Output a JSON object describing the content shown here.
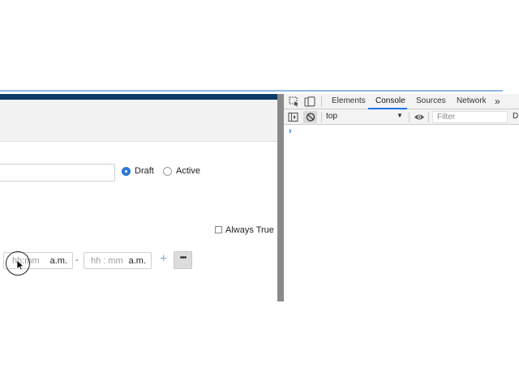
{
  "form": {
    "status_options": [
      {
        "label": "Draft",
        "selected": true
      },
      {
        "label": "Active",
        "selected": false
      }
    ],
    "always_true": {
      "label": "Always True",
      "checked": false
    },
    "time_range": {
      "start_placeholder": "hh:mm",
      "start_ampm": "a.m.",
      "separator": "-",
      "end_placeholder": "hh : mm",
      "end_ampm": "a.m.",
      "add_symbol": "+",
      "more_symbol": "•••"
    }
  },
  "devtools": {
    "tabs": [
      {
        "label": "Elements",
        "active": false
      },
      {
        "label": "Console",
        "active": true
      },
      {
        "label": "Sources",
        "active": false
      },
      {
        "label": "Network",
        "active": false
      }
    ],
    "more_tabs_symbol": "»",
    "context_selector": "top",
    "filter_placeholder": "Filter",
    "levels_truncated": "D",
    "prompt_symbol": "›"
  },
  "colors": {
    "app_header": "#0f3a68",
    "accent": "#2a78d6",
    "devtools_tab_active": "#1a73e8"
  }
}
